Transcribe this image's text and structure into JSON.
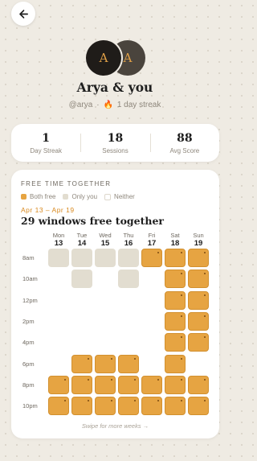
{
  "header": {
    "back_icon": "arrow-left-icon"
  },
  "profile": {
    "avatars": [
      "A",
      "A"
    ],
    "title": "Arya & you",
    "handle": "@arya",
    "separator": "·",
    "streak_icon": "fire-icon",
    "streak_glyph": "🔥",
    "streak_text": "1 day streak"
  },
  "stats": [
    {
      "value": "1",
      "label": "Day Streak"
    },
    {
      "value": "18",
      "label": "Sessions"
    },
    {
      "value": "88",
      "label": "Avg Score"
    }
  ],
  "free_time": {
    "title": "FREE TIME TOGETHER",
    "legend": [
      {
        "key": "both",
        "label": "Both free"
      },
      {
        "key": "you",
        "label": "Only you"
      },
      {
        "key": "neither",
        "label": "Neither"
      }
    ],
    "range": "Apr 13 – Apr 19",
    "headline": "29 windows free together",
    "days": [
      {
        "name": "Mon",
        "num": "13"
      },
      {
        "name": "Tue",
        "num": "14"
      },
      {
        "name": "Wed",
        "num": "15"
      },
      {
        "name": "Thu",
        "num": "16"
      },
      {
        "name": "Fri",
        "num": "17"
      },
      {
        "name": "Sat",
        "num": "18"
      },
      {
        "name": "Sun",
        "num": "19"
      }
    ],
    "time_labels": [
      "8am",
      "10am",
      "12pm",
      "2pm",
      "4pm",
      "6pm",
      "8pm",
      "10pm"
    ],
    "time_label_rows": [
      0,
      1,
      2,
      3,
      4,
      5,
      6,
      7
    ],
    "grid": [
      [
        "you",
        "you",
        "you",
        "you",
        "both",
        "both",
        "both"
      ],
      [
        "",
        "you",
        "",
        "you",
        "",
        "both",
        "both"
      ],
      [
        "",
        "",
        "",
        "",
        "",
        "both",
        "both"
      ],
      [
        "",
        "",
        "",
        "",
        "",
        "both",
        "both"
      ],
      [
        "",
        "",
        "",
        "",
        "",
        "both",
        "both"
      ],
      [
        "",
        "both",
        "both",
        "both",
        "",
        "both",
        ""
      ],
      [
        "both",
        "both",
        "both",
        "both",
        "both",
        "both",
        "both"
      ],
      [
        "both",
        "both",
        "both",
        "both",
        "both",
        "both",
        "both"
      ]
    ],
    "swipe_hint": "Swipe for more weeks →",
    "colors": {
      "both": "#e6a442",
      "you": "#e2ddd0",
      "accent": "#d8891f"
    }
  }
}
